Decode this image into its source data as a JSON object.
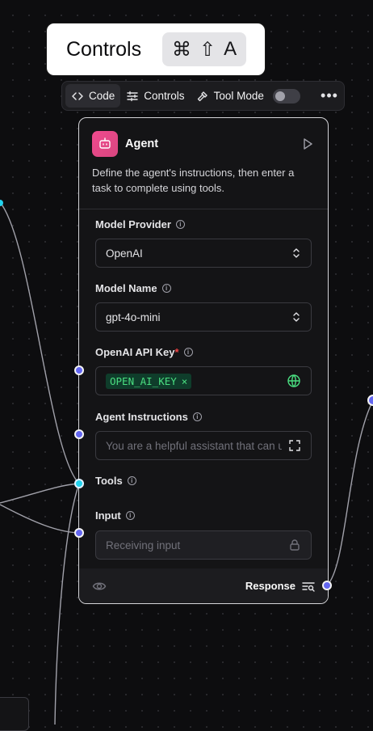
{
  "tooltip": {
    "label": "Controls",
    "shortcut": [
      "⌘",
      "⇧",
      "A"
    ]
  },
  "toolbar": {
    "code_label": "Code",
    "controls_label": "Controls",
    "tool_mode_label": "Tool Mode",
    "tool_mode_on": false,
    "more_label": "•••"
  },
  "node": {
    "title": "Agent",
    "description": "Define the agent's instructions, then enter a task to complete using tools.",
    "fields": {
      "model_provider": {
        "label": "Model Provider",
        "value": "OpenAI"
      },
      "model_name": {
        "label": "Model Name",
        "value": "gpt-4o-mini"
      },
      "api_key": {
        "label": "OpenAI API Key",
        "required_mark": "*",
        "value": "OPEN_AI_KEY"
      },
      "instructions": {
        "label": "Agent Instructions",
        "value": "You are a helpful assistant that can use tools to answer questions and perform tasks."
      },
      "tools": {
        "label": "Tools"
      },
      "input": {
        "label": "Input",
        "placeholder": "Receiving input"
      }
    },
    "output_label": "Response"
  },
  "colors": {
    "handle": "#6366f1",
    "handle_connected": "#22d3ee",
    "agent_icon": "#e8468a",
    "key_badge": "#4ade80"
  }
}
